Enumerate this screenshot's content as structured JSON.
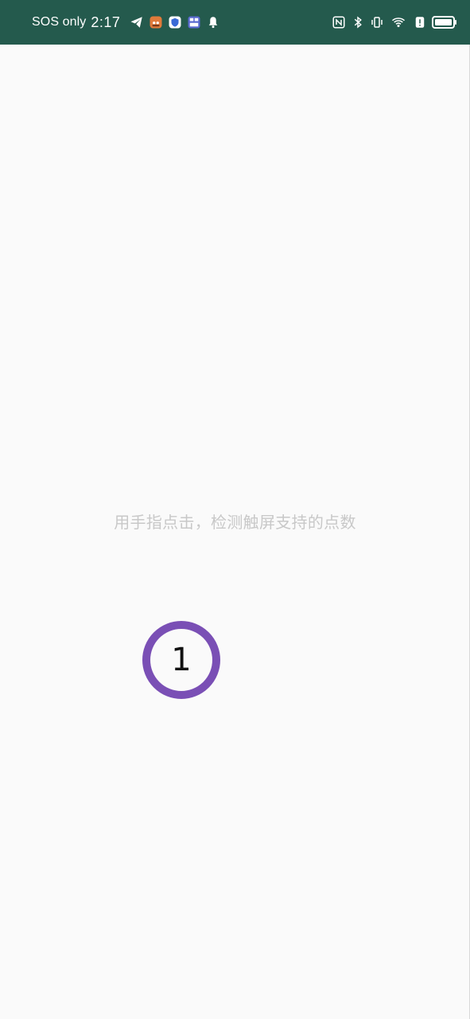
{
  "status_bar": {
    "carrier_text": "SOS only",
    "time": "2:17",
    "left_icons": [
      "telegram-icon",
      "cat-app-icon",
      "shield-app-icon",
      "calculator-app-icon",
      "bell-icon"
    ],
    "right_icons": [
      "nfc-icon",
      "bluetooth-icon",
      "vibrate-icon",
      "wifi-icon",
      "battery-saver-icon",
      "battery-icon"
    ],
    "background_color": "#245a4d"
  },
  "main": {
    "instruction": "用手指点击，检测触屏支持的点数",
    "touch_count": "1",
    "marker_color": "#7a4fb5",
    "background_color": "#fafafa"
  }
}
